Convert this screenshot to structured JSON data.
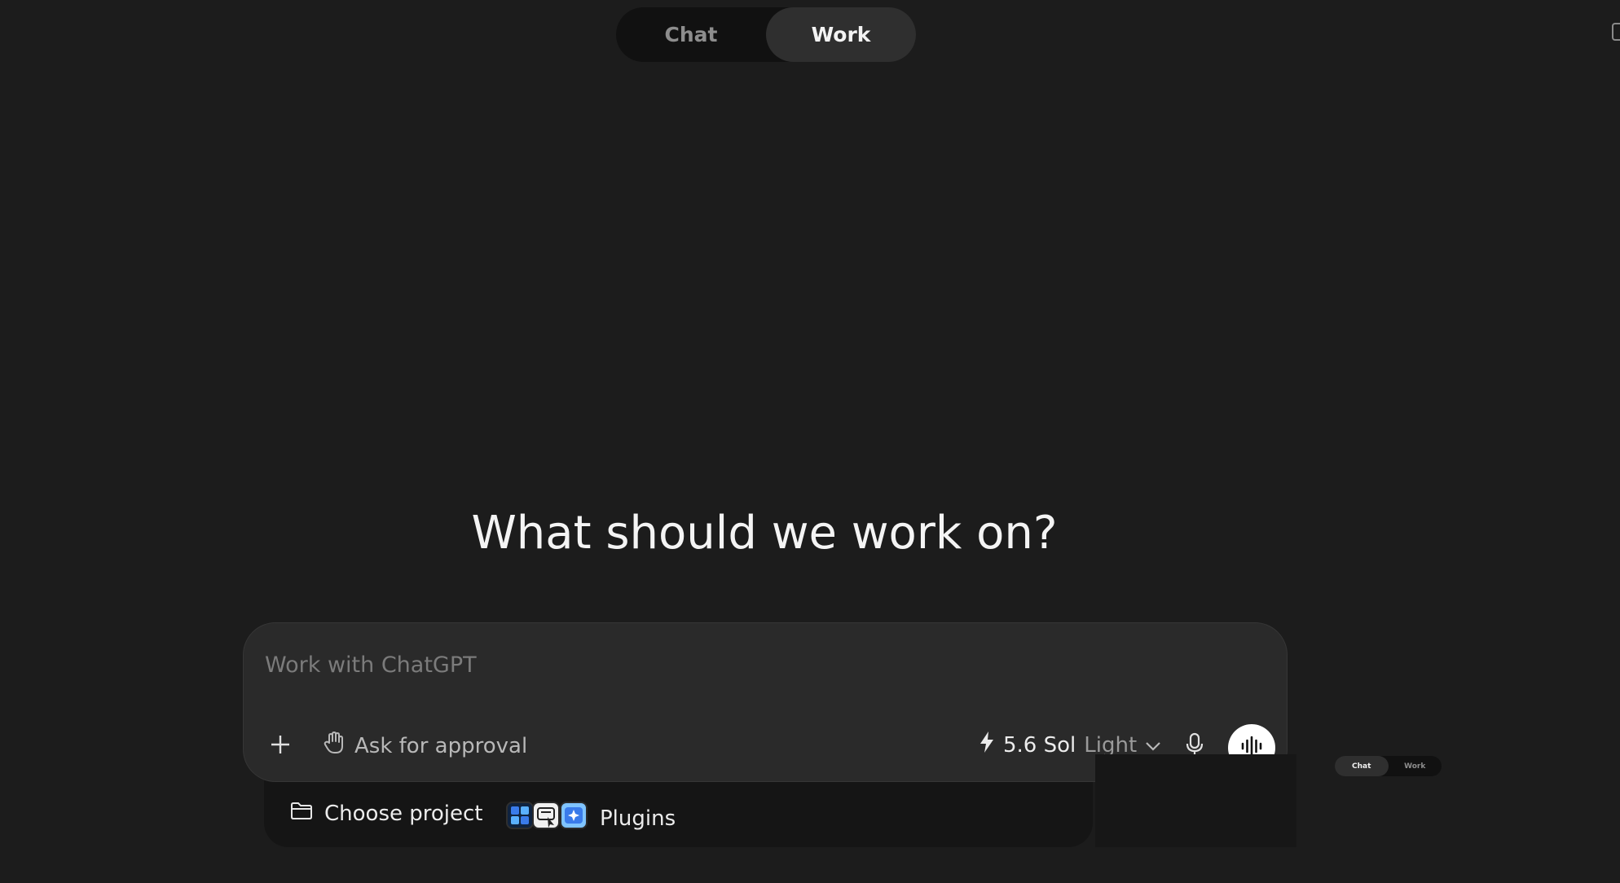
{
  "mode_toggle": {
    "tabs": [
      {
        "label": "Chat",
        "active": false
      },
      {
        "label": "Work",
        "active": true
      }
    ]
  },
  "headline": "What should we work on?",
  "composer": {
    "placeholder": "Work with ChatGPT",
    "value": "",
    "add_icon": "plus-icon",
    "approval": {
      "icon": "hand-icon",
      "label": "Ask for approval"
    },
    "model": {
      "icon": "lightning-icon",
      "name": "5.6 Sol",
      "effort": "Light",
      "dropdown_icon": "chevron-down-icon"
    },
    "mic_icon": "microphone-icon",
    "voice_icon": "voice-waveform-icon"
  },
  "tray": {
    "choose_project": {
      "icon": "folder-icon",
      "label": "Choose project"
    },
    "plugins": {
      "icon": "plugin-stack-icon",
      "label": "Plugins"
    }
  },
  "mini_preview": {
    "tabs": [
      {
        "label": "Chat",
        "active": true
      },
      {
        "label": "Work",
        "active": false
      }
    ]
  },
  "colors": {
    "background": "#1c1c1c",
    "composer": "#2a2a2a",
    "toggle_track": "#111111",
    "toggle_active": "#2f2f2f",
    "plugin_blue": "#3a7bea"
  }
}
